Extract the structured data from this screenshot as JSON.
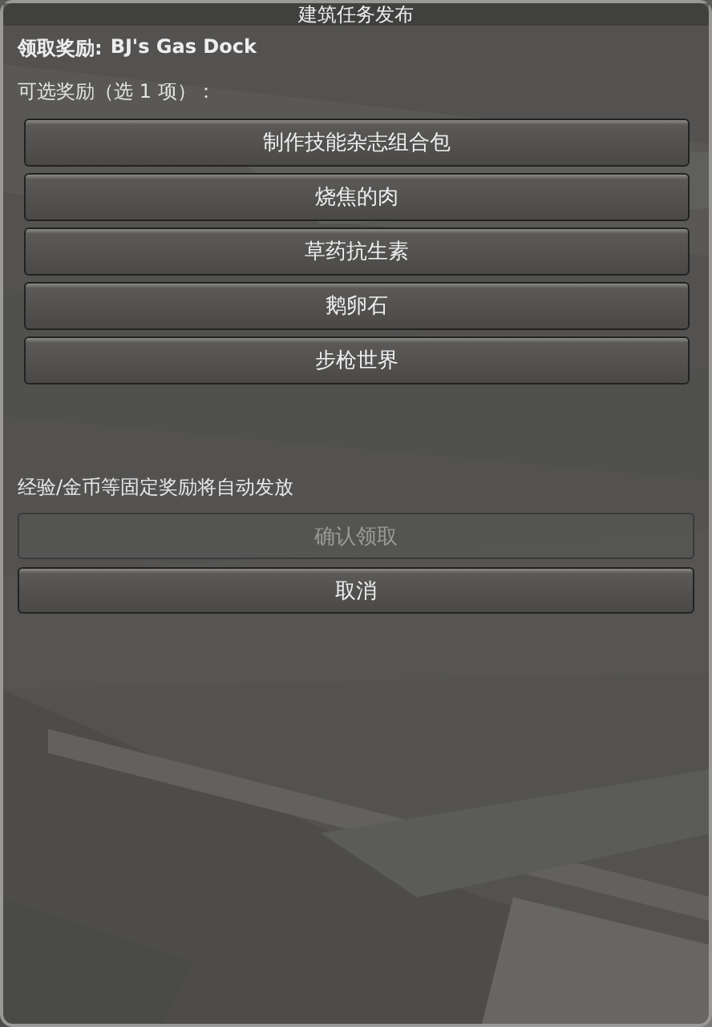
{
  "window": {
    "title": "建筑任务发布"
  },
  "reward_header": {
    "label": "领取奖励:",
    "name": "BJ's Gas Dock"
  },
  "choice_prompt": "可选奖励（选 1 项）：",
  "choices": [
    {
      "label": "制作技能杂志组合包"
    },
    {
      "label": "烧焦的肉"
    },
    {
      "label": "草药抗生素"
    },
    {
      "label": "鹅卵石"
    },
    {
      "label": "步枪世界"
    }
  ],
  "note": "经验/金币等固定奖励将自动发放",
  "buttons": [
    {
      "label": "确认领取",
      "disabled": true
    },
    {
      "label": "取消",
      "disabled": false
    }
  ]
}
